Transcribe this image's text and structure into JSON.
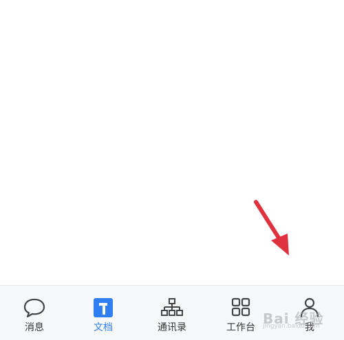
{
  "tabbar": {
    "tabs": [
      {
        "label": "消息",
        "icon": "chat-bubble-icon",
        "active": false
      },
      {
        "label": "文档",
        "icon": "document-icon",
        "active": true
      },
      {
        "label": "通讯录",
        "icon": "org-chart-icon",
        "active": false
      },
      {
        "label": "工作台",
        "icon": "grid-icon",
        "active": false
      },
      {
        "label": "我",
        "icon": "person-icon",
        "active": false
      }
    ]
  },
  "watermark": {
    "text": "Bai 经验",
    "sub": "jingyan.baidu.com"
  },
  "colors": {
    "accent": "#2f7ef2",
    "arrow": "#e0313f",
    "tab_label": "#333333",
    "icon_stroke": "#444444",
    "tabbar_bg": "#f7f8fa"
  }
}
